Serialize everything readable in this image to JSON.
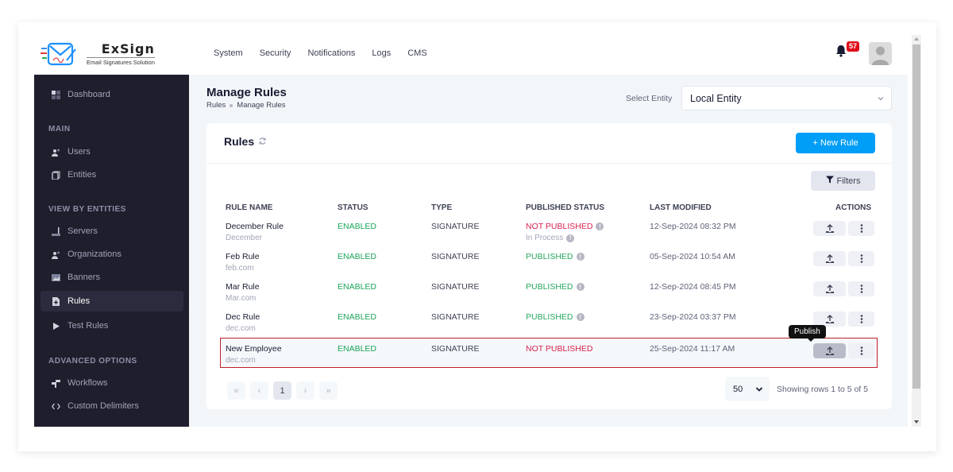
{
  "brand": {
    "name": "ExSign",
    "tagline": "Email Signatures Solution"
  },
  "topnav": [
    "System",
    "Security",
    "Notifications",
    "Logs",
    "CMS"
  ],
  "notifications": {
    "count": "57"
  },
  "sidebar": {
    "dashboard": "Dashboard",
    "sections": {
      "main": "MAIN",
      "view_by_entities": "VIEW BY ENTITIES",
      "advanced_options": "ADVANCED OPTIONS"
    },
    "items": {
      "users": "Users",
      "entities": "Entities",
      "servers": "Servers",
      "organizations": "Organizations",
      "banners": "Banners",
      "rules": "Rules",
      "test_rules": "Test Rules",
      "workflows": "Workflows",
      "custom_delimiters": "Custom Delimiters"
    },
    "active": "rules"
  },
  "page": {
    "title": "Manage Rules",
    "breadcrumb": [
      "Rules",
      "Manage Rules"
    ],
    "entity_label": "Select Entity",
    "entity_value": "Local Entity"
  },
  "card": {
    "title": "Rules",
    "new_rule": "+ New Rule",
    "filters": "Filters"
  },
  "table": {
    "columns": [
      "RULE NAME",
      "STATUS",
      "TYPE",
      "PUBLISHED STATUS",
      "LAST MODIFIED",
      "ACTIONS"
    ],
    "rows": [
      {
        "name": "December Rule",
        "domain": "December",
        "status": "ENABLED",
        "type": "SIGNATURE",
        "published": "NOT PUBLISHED",
        "published_state": "not",
        "sub_status": "In Process",
        "modified": "12-Sep-2024 08:32 PM"
      },
      {
        "name": "Feb Rule",
        "domain": "feb.com",
        "status": "ENABLED",
        "type": "SIGNATURE",
        "published": "PUBLISHED",
        "published_state": "yes",
        "modified": "05-Sep-2024 10:54 AM"
      },
      {
        "name": "Mar Rule",
        "domain": "Mar.com",
        "status": "ENABLED",
        "type": "SIGNATURE",
        "published": "PUBLISHED",
        "published_state": "yes",
        "modified": "12-Sep-2024 08:45 PM"
      },
      {
        "name": "Dec Rule",
        "domain": "dec.com",
        "status": "ENABLED",
        "type": "SIGNATURE",
        "published": "PUBLISHED",
        "published_state": "yes",
        "modified": "23-Sep-2024 03:37 PM"
      },
      {
        "name": "New Employee",
        "domain": "dec.com",
        "status": "ENABLED",
        "type": "SIGNATURE",
        "published": "NOT PUBLISHED",
        "published_state": "not",
        "modified": "25-Sep-2024 11:17 AM"
      }
    ]
  },
  "tooltip": "Publish",
  "pagination": {
    "first": "«",
    "prev": "‹",
    "current": "1",
    "next": "›",
    "last": "»",
    "page_size": "50",
    "rows_info": "Showing rows 1 to 5 of 5"
  },
  "colors": {
    "accent": "#009ef7",
    "enabled": "#1aa55a",
    "not_published": "#d9214e",
    "sidebar_bg": "#1e1e2d",
    "badge": "#e00d1a"
  }
}
